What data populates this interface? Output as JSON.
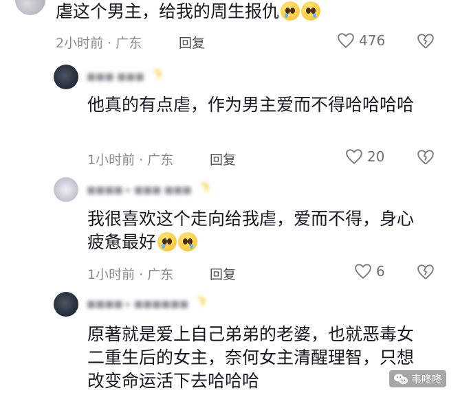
{
  "comments": [
    {
      "text": "虐这个男主，给我的周生报仇",
      "emoji_count": 2,
      "meta": "2小时前 · 广东",
      "reply": "回复",
      "likes": "476"
    },
    {
      "text": "他真的有点虐，作为男主爱而不得哈哈哈哈",
      "emoji_count": 0,
      "meta": "1小时前 · 广东",
      "reply": "回复",
      "likes": "20"
    },
    {
      "text": "我很喜欢这个走向给我虐，爱而不得，身心疲惫最好",
      "emoji_count": 2,
      "meta": "1小时前 · 广东",
      "reply": "回复",
      "likes": "6"
    },
    {
      "text": "原著就是爱上自己弟弟的老婆，也就恶毒女二重生后的女主，奈何女主清醒理智，只想改变命运活下去哈哈哈",
      "emoji_count": 0
    }
  ],
  "watermark": "韦咚咚",
  "icons": {
    "like": "heart-outline-icon",
    "dislike": "broken-heart-icon",
    "emoji": "crying-face-emoji",
    "watermark": "wechat-icon"
  }
}
